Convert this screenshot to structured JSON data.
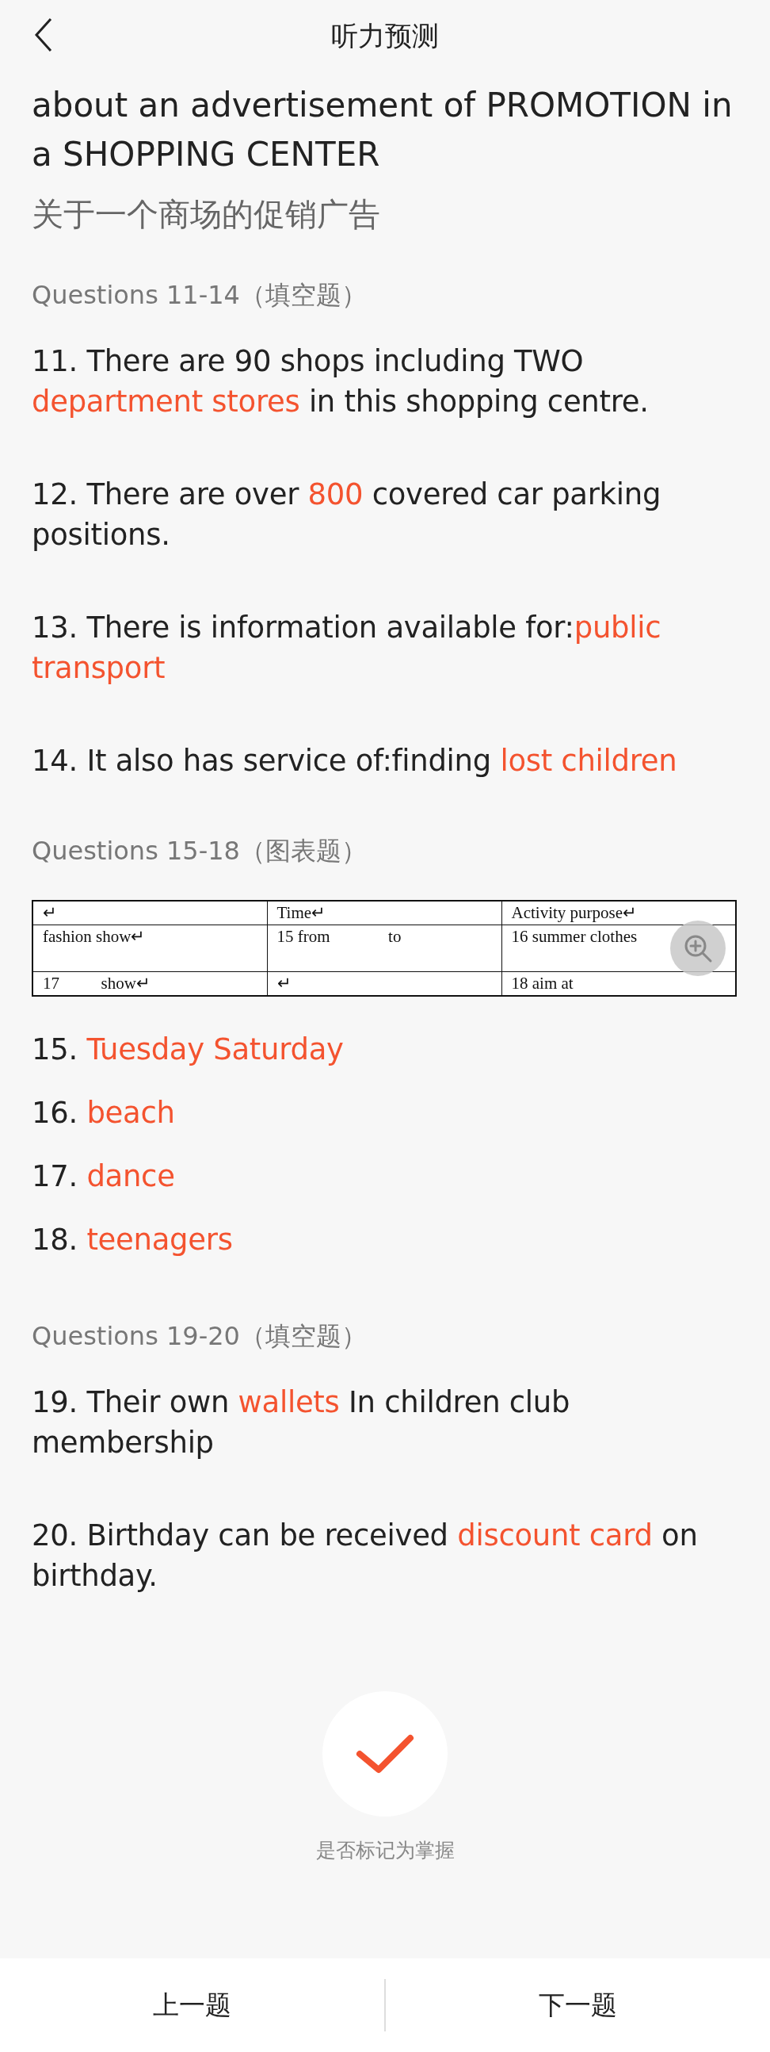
{
  "header": {
    "title": "听力预测"
  },
  "topic": {
    "english": "about an advertisement of PROMOTION in a SHOPPING CENTER",
    "chinese": "关于一个商场的促销广告"
  },
  "sections": [
    {
      "heading": "Questions 11-14（填空题）",
      "kind": "fill",
      "questions": [
        {
          "segments": [
            {
              "text": "11. There are 90 shops including TWO ",
              "answer": false
            },
            {
              "text": "department stores",
              "answer": true
            },
            {
              "text": " in this shopping centre.",
              "answer": false
            }
          ]
        },
        {
          "segments": [
            {
              "text": "12. There are over ",
              "answer": false
            },
            {
              "text": "800",
              "answer": true
            },
            {
              "text": " covered car parking positions.",
              "answer": false
            }
          ]
        },
        {
          "segments": [
            {
              "text": "13.  There is information available for:",
              "answer": false
            },
            {
              "text": "public transport",
              "answer": true
            }
          ]
        },
        {
          "segments": [
            {
              "text": "14. It also has service of:finding ",
              "answer": false
            },
            {
              "text": "lost children",
              "answer": true
            }
          ]
        }
      ]
    },
    {
      "heading": "Questions 15-18（图表题）",
      "kind": "table",
      "table": {
        "rows": [
          [
            "↵",
            "Time↵",
            "Activity purpose↵"
          ],
          [
            "fashion show↵",
            "15 from              to",
            "16 summer clothes"
          ],
          [
            "17          show↵",
            "↵",
            "18 aim at"
          ]
        ]
      },
      "questions": [
        {
          "segments": [
            {
              "text": "15. ",
              "answer": false
            },
            {
              "text": "Tuesday  Saturday",
              "answer": true
            }
          ]
        },
        {
          "segments": [
            {
              "text": "16. ",
              "answer": false
            },
            {
              "text": "beach",
              "answer": true
            }
          ]
        },
        {
          "segments": [
            {
              "text": "17. ",
              "answer": false
            },
            {
              "text": "dance",
              "answer": true
            }
          ]
        },
        {
          "segments": [
            {
              "text": "18. ",
              "answer": false
            },
            {
              "text": "teenagers",
              "answer": true
            }
          ]
        }
      ]
    },
    {
      "heading": "Questions 19-20（填空题）",
      "kind": "fill",
      "questions": [
        {
          "segments": [
            {
              "text": "19. Their own ",
              "answer": false
            },
            {
              "text": "wallets",
              "answer": true
            },
            {
              "text": " In children club membership",
              "answer": false
            }
          ]
        },
        {
          "segments": [
            {
              "text": "20. Birthday can be received ",
              "answer": false
            },
            {
              "text": "discount card",
              "answer": true
            },
            {
              "text": " on birthday.",
              "answer": false
            }
          ]
        }
      ]
    }
  ],
  "mastered": {
    "checked": true,
    "label": "是否标记为掌握"
  },
  "nav": {
    "prev": "上一题",
    "next": "下一题"
  }
}
